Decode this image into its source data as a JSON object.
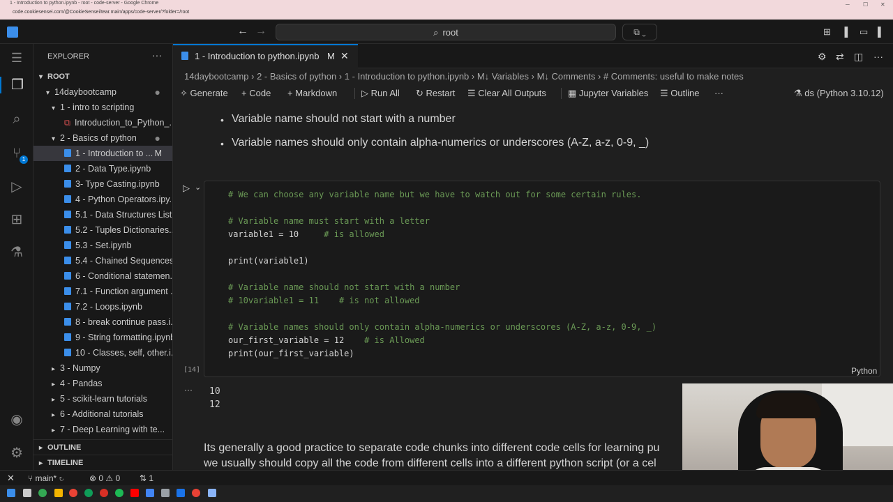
{
  "browser": {
    "title": "1 - Introduction to python.ipynb - root - code-server - Google Chrome",
    "url": "code.cookiesensei.com/@CookieSensei/tear.main/apps/code-server/?folder=/root"
  },
  "titlebar": {
    "search_text": "root"
  },
  "sidebar": {
    "title": "EXPLORER",
    "root_label": "ROOT",
    "tree": [
      {
        "label": "14daybootcamp",
        "indent": 1,
        "chev": "▾",
        "dot": true
      },
      {
        "label": "1 - intro to scripting",
        "indent": 2,
        "chev": "▾"
      },
      {
        "label": "Introduction_to_Python_...",
        "indent": 3,
        "pdf": true
      },
      {
        "label": "2 - Basics of python",
        "indent": 2,
        "chev": "▾",
        "dot": true
      },
      {
        "label": "1 - Introduction to ...",
        "indent": 3,
        "file": true,
        "selected": true,
        "mod": "M"
      },
      {
        "label": "2 - Data Type.ipynb",
        "indent": 3,
        "file": true
      },
      {
        "label": "3- Type Casting.ipynb",
        "indent": 3,
        "file": true
      },
      {
        "label": "4 - Python Operators.ipy...",
        "indent": 3,
        "file": true
      },
      {
        "label": "5.1 - Data Structures List...",
        "indent": 3,
        "file": true
      },
      {
        "label": "5.2 -  Tuples Dictionaries...",
        "indent": 3,
        "file": true
      },
      {
        "label": "5.3 - Set.ipynb",
        "indent": 3,
        "file": true
      },
      {
        "label": "5.4 - Chained Sequences...",
        "indent": 3,
        "file": true
      },
      {
        "label": "6 - Conditional statemen...",
        "indent": 3,
        "file": true
      },
      {
        "label": "7.1 - Function argument ...",
        "indent": 3,
        "file": true
      },
      {
        "label": "7.2 - Loops.ipynb",
        "indent": 3,
        "file": true
      },
      {
        "label": "8 - break continue pass.i...",
        "indent": 3,
        "file": true
      },
      {
        "label": "9 - String formatting.ipynb",
        "indent": 3,
        "file": true
      },
      {
        "label": "10 - Classes, self, other.i...",
        "indent": 3,
        "file": true
      },
      {
        "label": "3 - Numpy",
        "indent": 2,
        "chev": "▸"
      },
      {
        "label": "4 - Pandas",
        "indent": 2,
        "chev": "▸"
      },
      {
        "label": "5 - scikit-learn tutorials",
        "indent": 2,
        "chev": "▸"
      },
      {
        "label": "6 - Additional tutorials",
        "indent": 2,
        "chev": "▸"
      },
      {
        "label": "7 - Deep Learning with te...",
        "indent": 2,
        "chev": "▸"
      }
    ],
    "outline_label": "OUTLINE",
    "timeline_label": "TIMELINE"
  },
  "tab": {
    "label": "1 - Introduction to python.ipynb",
    "modified": "M"
  },
  "breadcrumb": "14daybootcamp  ›  2 - Basics of python  ›  1 - Introduction to python.ipynb  ›  M↓ Variables  ›  M↓ Comments  ›  # Comments: useful to make notes",
  "toolbar": {
    "generate": "Generate",
    "code": "Code",
    "markdown": "Markdown",
    "run_all": "Run All",
    "restart": "Restart",
    "clear_outputs": "Clear All Outputs",
    "jupyter_variables": "Jupyter Variables",
    "outline": "Outline",
    "more": "···",
    "kernel": "ds (Python 3.10.12)"
  },
  "markdown": {
    "bullet1": "Variable name should not start with a number",
    "bullet2": "Variable names should only contain alpha-numerics or underscores (A-Z, a-z, 0-9, _)"
  },
  "cell": {
    "exec_count": "[14]",
    "language": "Python",
    "lines": [
      {
        "text": "# We can choose any variable name but we have to watch out for some certain rules.",
        "comment": true
      },
      {
        "text": "",
        "comment": false
      },
      {
        "text": "# Variable name must start with a letter",
        "comment": true
      },
      {
        "text": "variable1 = 10",
        "comment": false,
        "trail": "     # is allowed"
      },
      {
        "text": "",
        "comment": false
      },
      {
        "text": "print(variable1)",
        "comment": false
      },
      {
        "text": "",
        "comment": false
      },
      {
        "text": "# Variable name should not start with a number",
        "comment": true
      },
      {
        "text": "# 10variable1 = 11    # is not allowed",
        "comment": true
      },
      {
        "text": "",
        "comment": false
      },
      {
        "text": "# Variable names should only contain alpha-numerics or underscores (A-Z, a-z, 0-9, _)",
        "comment": true
      },
      {
        "text": "our_first_variable = 12",
        "comment": false,
        "trail": "    # is Allowed"
      },
      {
        "text": "print(our_first_variable)",
        "comment": false
      }
    ],
    "outputs": [
      "10",
      "12"
    ]
  },
  "paragraph": {
    "line1": "Its generally a good practice to separate code chunks into different code cells for learning pu",
    "line2": "we usually should copy all the code from different cells into a different python script (or a cel"
  },
  "statusbar": {
    "branch": "main*",
    "errors": "0",
    "warnings": "0",
    "ports": "1"
  },
  "colors": {
    "accent": "#0078d4",
    "comment": "#6a9955",
    "background": "#1f1f1f"
  }
}
